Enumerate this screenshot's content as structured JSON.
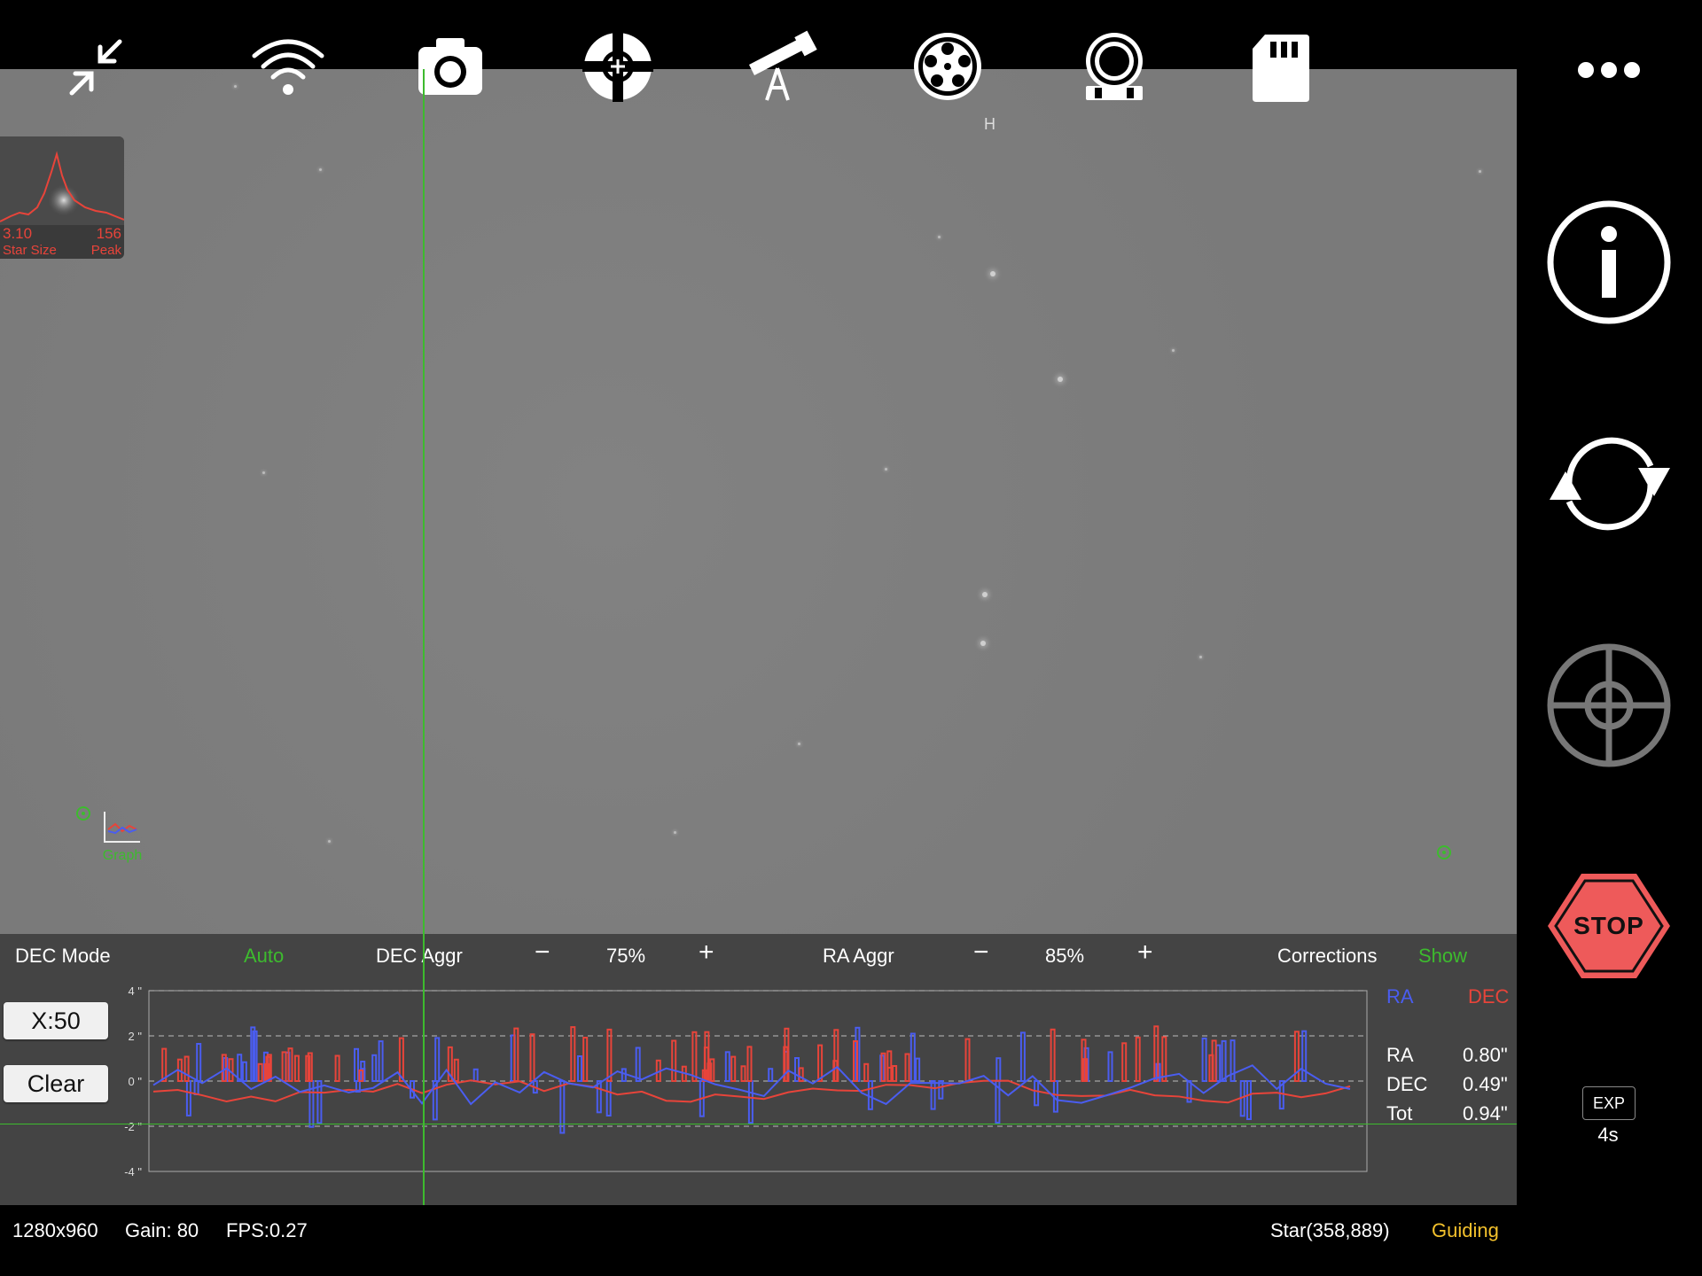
{
  "toolbar": {
    "icons": [
      "collapse-icon",
      "wifi-icon",
      "camera-icon",
      "guide-target-icon",
      "telescope-icon",
      "filter-wheel-icon",
      "focuser-icon",
      "sd-card-icon"
    ],
    "filter_label": "H"
  },
  "sidebar": {
    "more_icon": "more-icon",
    "info_icon": "info-icon",
    "loop_icon": "loop-icon",
    "target_icon": "crosshair-icon",
    "stop_label": "STOP",
    "exp_label": "EXP",
    "exp_value": "4s"
  },
  "star_profile": {
    "star_size": "3.10",
    "peak": "156",
    "star_size_label": "Star Size",
    "peak_label": "Peak"
  },
  "graph_toggle_label": "Graph",
  "controls": {
    "dec_mode_label": "DEC Mode",
    "dec_mode_value": "Auto",
    "dec_aggr_label": "DEC Aggr",
    "dec_aggr_value": "75%",
    "ra_aggr_label": "RA Aggr",
    "ra_aggr_value": "85%",
    "minus": "−",
    "plus": "+",
    "corrections_label": "Corrections",
    "corrections_value": "Show",
    "x_scale_button": "X:50",
    "clear_button": "Clear"
  },
  "graph": {
    "y_ticks": [
      "4 \"",
      "2 \"",
      "0 \"",
      "-2 \"",
      "-4 \""
    ],
    "legend_ra": "RA",
    "legend_dec": "DEC"
  },
  "stats": {
    "ra_label": "RA",
    "ra_value": "0.80\"",
    "dec_label": "DEC",
    "dec_value": "0.49\"",
    "tot_label": "Tot",
    "tot_value": "0.94\""
  },
  "status": {
    "resolution": "1280x960",
    "gain": "Gain: 80",
    "fps": "FPS:0.27",
    "star": "Star(358,889)",
    "state": "Guiding"
  },
  "colors": {
    "ra": "#4a5df0",
    "dec": "#e8443a",
    "accent_green": "#3dbb2e",
    "guiding": "#f3c12c",
    "stop": "#ee5a5a"
  }
}
